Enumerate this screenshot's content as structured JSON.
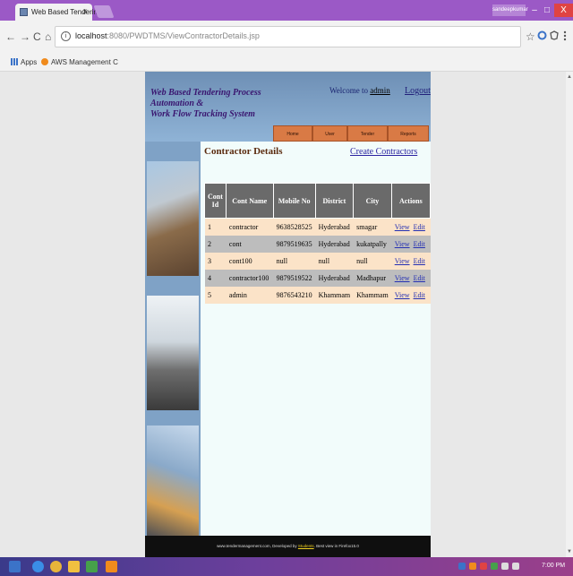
{
  "browser": {
    "tab_title": "Web Based Tendering P",
    "tab_close": "x",
    "user_chip": "sandeepkumar",
    "win_min": "–",
    "win_max": "□",
    "win_close": "X",
    "back_icon": "←",
    "forward_icon": "→",
    "reload_icon": "C",
    "home_icon": "⌂",
    "info_icon": "i",
    "url_host": "localhost",
    "url_rest": ":8080/PWDTMS/ViewContractorDetails.jsp",
    "star_icon": "☆",
    "bookmarks": [
      {
        "label": "Apps",
        "icon": "apps-icon"
      },
      {
        "label": "AWS Management C",
        "icon": "aws-icon"
      }
    ]
  },
  "site": {
    "logo_line1": "Web Based Tendering Process Automation &",
    "logo_line2": "Work Flow Tracking System",
    "welcome_prefix": "Welcome to ",
    "welcome_user": "admin",
    "logout": "Logout",
    "menu": [
      "Home",
      "User",
      "Tender",
      "Reports"
    ],
    "section_title": "Contractor Details",
    "create_link": "Create Contractors",
    "table": {
      "headers": [
        "Cont Id",
        "Cont Name",
        "Mobile No",
        "District",
        "City",
        "Actions"
      ],
      "rows": [
        {
          "id": "1",
          "name": "contractor",
          "mobile": "9638528525",
          "district": "Hyderabad",
          "city": "smagar",
          "view": "View",
          "edit": "Edit"
        },
        {
          "id": "2",
          "name": "cont",
          "mobile": "9879519635",
          "district": "Hyderabad",
          "city": "kukatpally",
          "view": "View",
          "edit": "Edit"
        },
        {
          "id": "3",
          "name": "cont100",
          "mobile": "null",
          "district": "null",
          "city": "null",
          "view": "View",
          "edit": "Edit"
        },
        {
          "id": "4",
          "name": "contractor100",
          "mobile": "9879519522",
          "district": "Hyderabad",
          "city": "Madhapur",
          "view": "View",
          "edit": "Edit"
        },
        {
          "id": "5",
          "name": "admin",
          "mobile": "9876543210",
          "district": "Khammam",
          "city": "Khammam",
          "view": "View",
          "edit": "Edit"
        }
      ]
    },
    "footer_prefix": "www.tendermanagement.com, Developed by ",
    "footer_link": "Students",
    "footer_suffix": ". Best view in Firefox15.0"
  },
  "taskbar": {
    "clock": "7:00 PM",
    "colors": {
      "start": "#3b73c8",
      "ie": "#3a8ee6",
      "chrome": "#e8b53a",
      "explorer": "#f0c040",
      "media": "#46a04a",
      "app": "#f08b1d"
    }
  }
}
